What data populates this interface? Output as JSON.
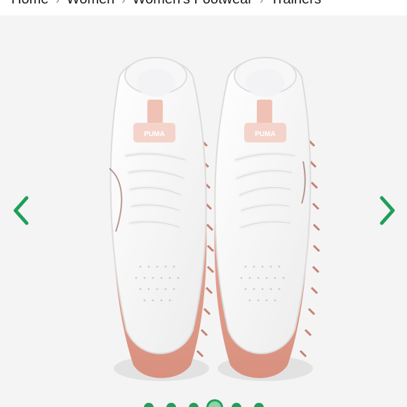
{
  "breadcrumb": {
    "items": [
      "Home",
      "Women",
      "Women's Footwear",
      "Trainers"
    ],
    "separator": "›"
  },
  "gallery": {
    "image_alt": "White sneakers with pink sole",
    "brand_label": "PUMA",
    "prev_icon": "chevron-left-icon",
    "next_icon": "chevron-right-icon",
    "accent_color": "#1e9f5a",
    "slide_count": 6,
    "active_slide": 4
  }
}
